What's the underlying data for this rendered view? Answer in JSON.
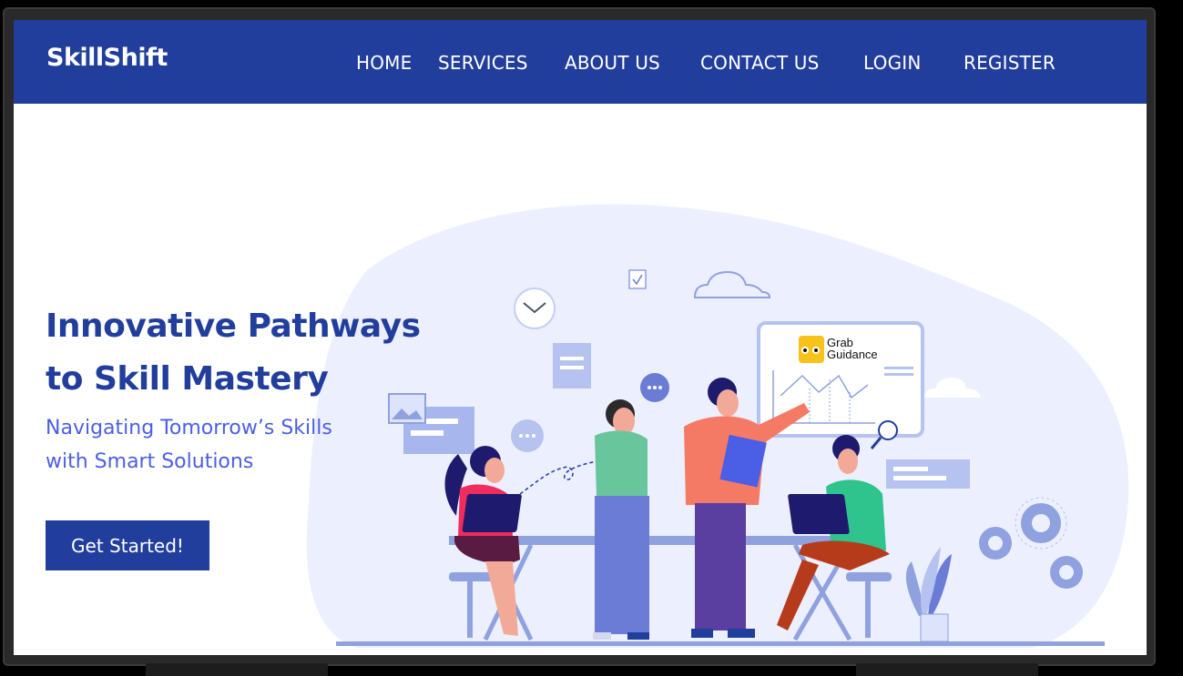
{
  "brand": {
    "name": "SkillShift"
  },
  "nav": {
    "home": "HOME",
    "services": "SERVICES",
    "about": "ABOUT US",
    "contact": "CONTACT US",
    "login": "LOGIN",
    "register": "REGISTER"
  },
  "hero": {
    "title_line1": "Innovative Pathways",
    "title_line2": "to Skill Mastery",
    "subtitle_line1": "Navigating Tomorrow’s Skills",
    "subtitle_line2": "with Smart Solutions",
    "cta_label": "Get Started!"
  },
  "illustration": {
    "board_logo_line1": "Grab",
    "board_logo_line2": "Guidance"
  },
  "colors": {
    "primary": "#223e9c",
    "accent": "#4b5ee6",
    "illustration_bg": "#eceffd"
  }
}
